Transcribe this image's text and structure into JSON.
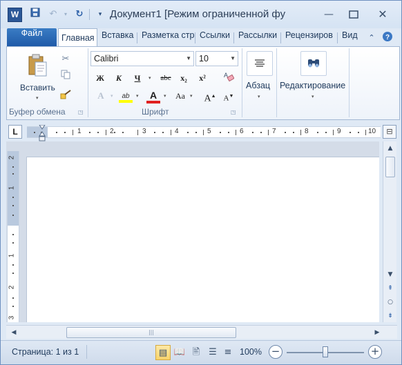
{
  "window": {
    "title": "Документ1 [Режим ограниченной фу",
    "app_icon": "W",
    "controls": [
      "minimize-icon",
      "maximize-icon",
      "close-icon"
    ]
  },
  "quick_access": [
    "save-icon",
    "undo-icon",
    "redo-icon",
    "customize-icon"
  ],
  "tabs": {
    "file": "Файл",
    "items": [
      "Главная",
      "Вставка",
      "Разметка стр",
      "Ссылки",
      "Рассылки",
      "Рецензиров",
      "Вид"
    ],
    "active": "Главная"
  },
  "ribbon": {
    "clipboard": {
      "label": "Буфер обмена",
      "paste_label": "Вставить"
    },
    "font": {
      "label": "Шрифт",
      "font_name": "Calibri",
      "font_size": "10",
      "bold": "Ж",
      "italic": "К",
      "underline": "Ч",
      "strike": "abc",
      "subscript": "x₂",
      "superscript": "x²",
      "case": "Aa",
      "grow": "A",
      "shrink": "A",
      "highlight_color": "#ffff00",
      "font_color": "#e02020"
    },
    "paragraph": {
      "label": "Абзац"
    },
    "editing": {
      "label": "Редактирование"
    }
  },
  "ruler": {
    "tab_selector": "L",
    "h_numbers": [
      "1",
      "1",
      "2",
      "3",
      "4",
      "5",
      "6",
      "7",
      "8",
      "9",
      "10"
    ],
    "v_numbers": [
      "2",
      "1",
      "1",
      "2",
      "3"
    ]
  },
  "statusbar": {
    "page": "Страница: 1 из 1",
    "zoom": "100%",
    "zoom_out": "−",
    "zoom_in": "+"
  }
}
